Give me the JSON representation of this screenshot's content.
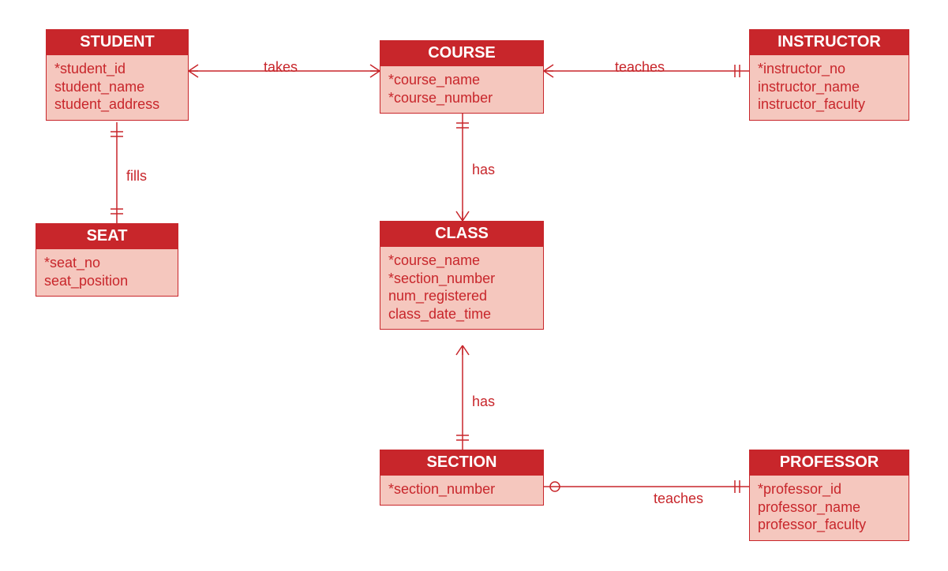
{
  "entities": {
    "student": {
      "title": "STUDENT",
      "attrs": [
        "*student_id",
        "student_name",
        "student_address"
      ]
    },
    "course": {
      "title": "COURSE",
      "attrs": [
        "*course_name",
        "*course_number"
      ]
    },
    "instructor": {
      "title": "INSTRUCTOR",
      "attrs": [
        "*instructor_no",
        "instructor_name",
        "instructor_faculty"
      ]
    },
    "seat": {
      "title": "SEAT",
      "attrs": [
        "*seat_no",
        "seat_position"
      ]
    },
    "class": {
      "title": "CLASS",
      "attrs": [
        "*course_name",
        "*section_number",
        "num_registered",
        "class_date_time"
      ]
    },
    "section": {
      "title": "SECTION",
      "attrs": [
        "*section_number"
      ]
    },
    "professor": {
      "title": "PROFESSOR",
      "attrs": [
        "*professor_id",
        "professor_name",
        "professor_faculty"
      ]
    }
  },
  "relationships": {
    "takes": "takes",
    "teaches1": "teaches",
    "fills": "fills",
    "has1": "has",
    "has2": "has",
    "teaches2": "teaches"
  },
  "colors": {
    "accent": "#c8262b",
    "fill": "#f5c7be"
  }
}
